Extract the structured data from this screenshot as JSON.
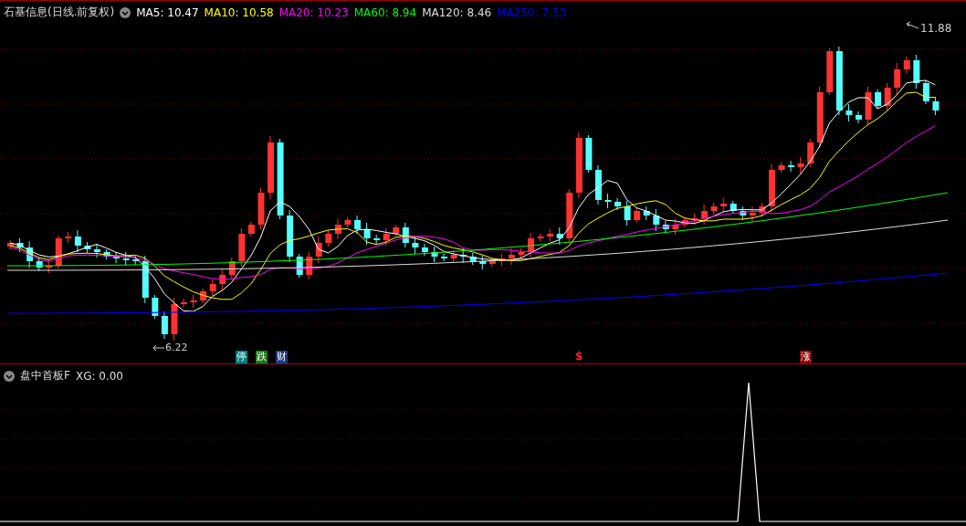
{
  "main_panel": {
    "title": "石基信息(日线.前复权)",
    "ma_legend": [
      {
        "label": "MA5: 10.47",
        "color": "#ffffff"
      },
      {
        "label": "MA10: 10.58",
        "color": "#ffff00"
      },
      {
        "label": "MA20: 10.23",
        "color": "#ff00ff"
      },
      {
        "label": "MA60: 8.94",
        "color": "#00ff00"
      },
      {
        "label": "MA120: 8.46",
        "color": "#dddddd"
      },
      {
        "label": "MA250: 7.53",
        "color": "#0000ff"
      }
    ],
    "high_label": "11.88",
    "low_label": "6.22",
    "markers": [
      {
        "kind": "badge",
        "text": "停",
        "color": "#008080"
      },
      {
        "kind": "badge",
        "text": "跌",
        "color": "#1a7a1a"
      },
      {
        "kind": "badge",
        "text": "财",
        "color": "#1c3a7a"
      },
      {
        "kind": "symbol",
        "text": "$",
        "color": "#ff2020"
      },
      {
        "kind": "badge",
        "text": "涨",
        "color": "#8b0000"
      }
    ]
  },
  "indicator_panel": {
    "title": "盘中首板F",
    "reading": "XG: 0.00"
  }
}
